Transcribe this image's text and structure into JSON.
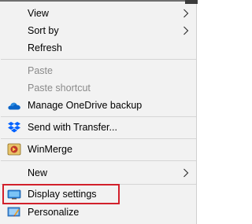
{
  "context_menu": {
    "items": [
      {
        "label": "View",
        "has_submenu": true,
        "enabled": true
      },
      {
        "label": "Sort by",
        "has_submenu": true,
        "enabled": true
      },
      {
        "label": "Refresh",
        "has_submenu": false,
        "enabled": true
      },
      {
        "label": "Paste",
        "has_submenu": false,
        "enabled": false
      },
      {
        "label": "Paste shortcut",
        "has_submenu": false,
        "enabled": false
      },
      {
        "label": "Manage OneDrive backup",
        "icon": "onedrive-cloud-icon",
        "enabled": true
      },
      {
        "label": "Send with Transfer...",
        "icon": "dropbox-transfer-icon",
        "enabled": true
      },
      {
        "label": "WinMerge",
        "icon": "winmerge-icon",
        "enabled": true
      },
      {
        "label": "New",
        "has_submenu": true,
        "enabled": true
      },
      {
        "label": "Display settings",
        "icon": "display-monitor-icon",
        "enabled": true,
        "highlighted": true
      },
      {
        "label": "Personalize",
        "icon": "personalize-icon",
        "enabled": true
      }
    ]
  },
  "colors": {
    "menu_background": "#f2f2f2",
    "disabled_text": "#8a8a8a",
    "highlight_border": "#d2202b",
    "onedrive_blue": "#0a64c8",
    "dropbox_blue": "#0061ff"
  }
}
